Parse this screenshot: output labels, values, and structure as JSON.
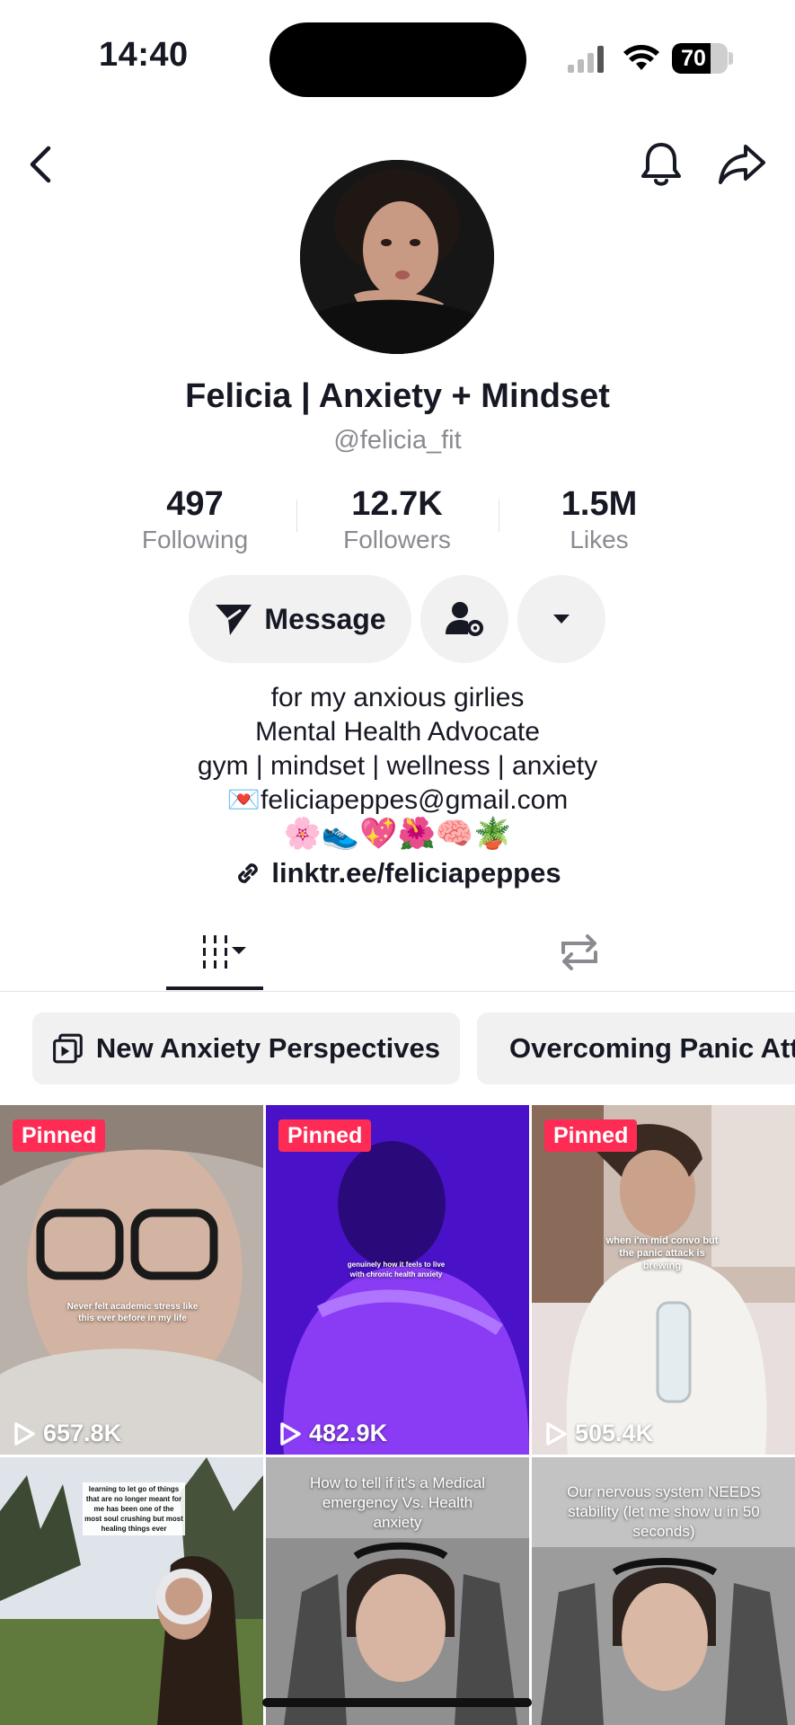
{
  "status_bar": {
    "time": "14:40",
    "battery": "70",
    "battery_level": 0.7
  },
  "nav": {
    "back_icon": "chevron-left-icon",
    "bell_icon": "bell-icon",
    "share_icon": "share-arrow-icon"
  },
  "profile": {
    "display_name": "Felicia | Anxiety + Mindset",
    "handle": "@felicia_fit",
    "stats": [
      {
        "value": "497",
        "label": "Following"
      },
      {
        "value": "12.7K",
        "label": "Followers"
      },
      {
        "value": "1.5M",
        "label": "Likes"
      }
    ]
  },
  "actions": {
    "message_label": "Message"
  },
  "bio": {
    "lines": [
      "for my anxious girlies",
      "Mental Health Advocate",
      "gym | mindset | wellness | anxiety"
    ],
    "email": "💌feliciapeppes@gmail.com",
    "emojis": "🌸👟💖🌺🧠🪴",
    "link": "linktr.ee/feliciapeppes"
  },
  "tabs": {
    "videos_icon": "grid-icon",
    "reposts_icon": "repost-icon"
  },
  "playlists": [
    "New Anxiety Perspectives",
    "Overcoming Panic Attacks"
  ],
  "videos": [
    {
      "pinned": "Pinned",
      "views": "657.8K",
      "caption": "Never felt academic stress like this ever before in my life"
    },
    {
      "pinned": "Pinned",
      "views": "482.9K",
      "caption": "genuinely how it feels to live with chronic health anxiety"
    },
    {
      "pinned": "Pinned",
      "views": "505.4K",
      "caption": "when i'm mid convo but the panic attack is brewing"
    },
    {
      "caption": "learning to let go of things that are no longer meant for me has been one of the most soul crushing but most healing things ever"
    },
    {
      "caption": "How to tell if it's a Medical emergency Vs. Health anxiety"
    },
    {
      "caption": "Our nervous system NEEDS stability (let me show u in 50 seconds)"
    }
  ],
  "colors": {
    "accent": "#fe2c55",
    "text": "#161823",
    "muted": "#8a8b91",
    "chip_bg": "#f1f1f2"
  }
}
